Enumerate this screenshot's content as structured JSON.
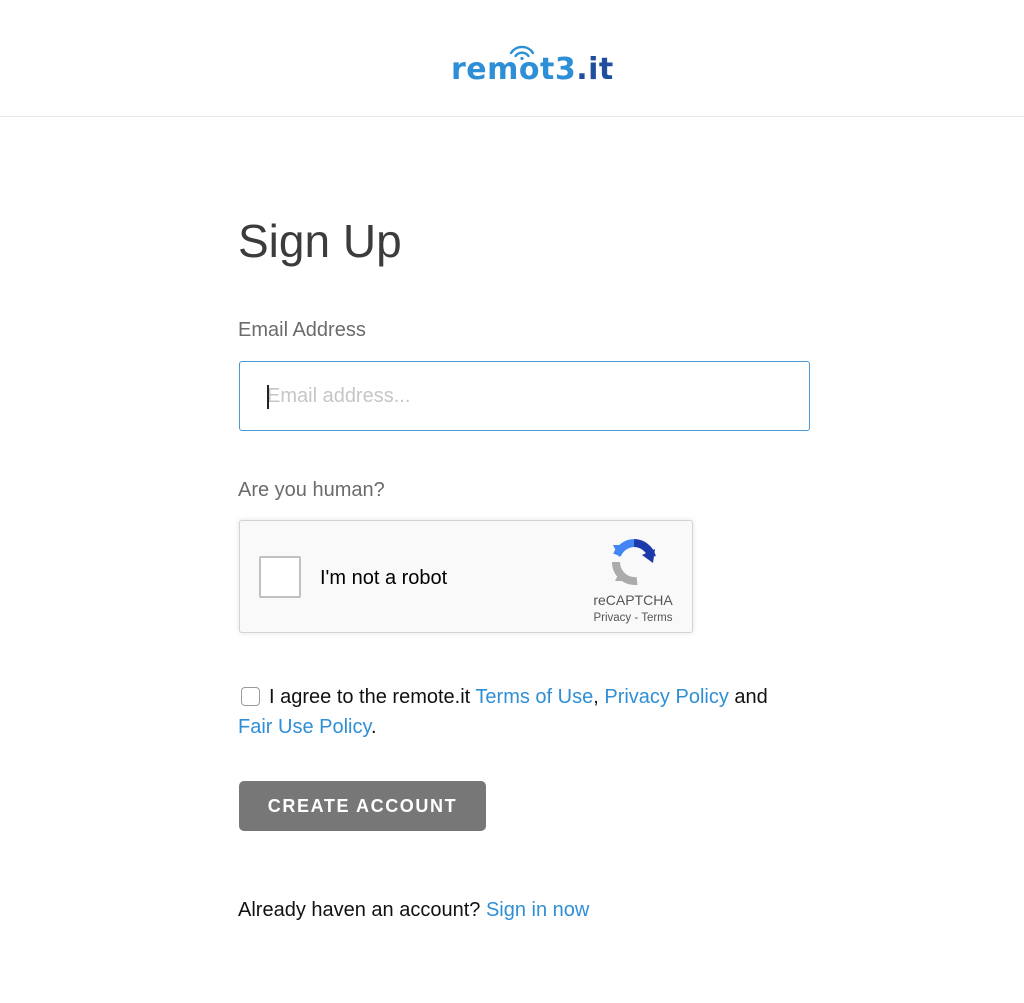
{
  "header": {
    "logo": {
      "text_light": "remot",
      "text_mid": "3",
      "text_dark": ".it",
      "colors": {
        "blue": "#2f8fd6",
        "navy": "#1f4f9c"
      }
    }
  },
  "form": {
    "title": "Sign Up",
    "email": {
      "label": "Email Address",
      "value": "",
      "placeholder": "Email address..."
    },
    "captcha": {
      "label": "Are you human?",
      "checkbox_label": "I'm not a robot",
      "brand": "reCAPTCHA",
      "privacy": "Privacy",
      "separator": " - ",
      "terms": "Terms"
    },
    "agreement": {
      "prefix": "I agree to the remote.it ",
      "terms_link": "Terms of Use",
      "comma": ",",
      "privacy_link": "Privacy Policy",
      "and": " and",
      "fair_use_link": "Fair Use Policy",
      "period": ".",
      "checked": false
    },
    "submit_label": "CREATE ACCOUNT",
    "signin": {
      "prompt": "Already haven an account?",
      "link": "Sign in now"
    }
  },
  "colors": {
    "accent": "#2f8fd6",
    "button": "#777777",
    "input_border": "#4a9ad8"
  }
}
